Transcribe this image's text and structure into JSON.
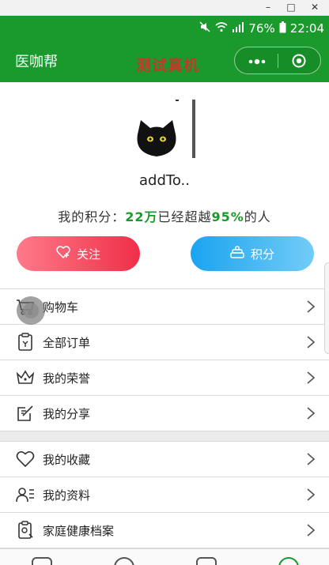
{
  "status_bar": {
    "battery": "76%",
    "time": "22:04"
  },
  "nav": {
    "title": "医咖帮",
    "banner": "测试真机"
  },
  "profile": {
    "name": "addTo..",
    "points_prefix": "我的积分：",
    "points_value": "22万",
    "points_middle": "已经超越",
    "points_percent": "95%",
    "points_suffix": "的人"
  },
  "buttons": {
    "follow": "关注",
    "points": "积分"
  },
  "menu_group1": [
    {
      "label": "购物车",
      "icon": "cart-icon"
    },
    {
      "label": "全部订单",
      "icon": "order-icon"
    },
    {
      "label": "我的荣誉",
      "icon": "crown-icon"
    },
    {
      "label": "我的分享",
      "icon": "share-icon"
    }
  ],
  "menu_group2": [
    {
      "label": "我的收藏",
      "icon": "heart-icon"
    },
    {
      "label": "我的资料",
      "icon": "profile-card-icon"
    },
    {
      "label": "家庭健康档案",
      "icon": "health-record-icon"
    }
  ],
  "colors": {
    "brand_green": "#1a9a2c",
    "follow_red": "#ef2f48",
    "points_blue": "#1aa4f0"
  }
}
